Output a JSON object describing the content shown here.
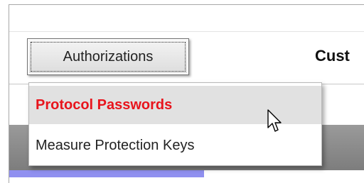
{
  "toolbar": {
    "authorizations_label": "Authorizations",
    "page_title": "Cust"
  },
  "menu": {
    "items": [
      {
        "label": "Protocol Passwords",
        "state": "highlighted"
      },
      {
        "label": "Measure Protection Keys",
        "state": "normal"
      }
    ]
  },
  "progress": {
    "fraction": 0.55
  },
  "colors": {
    "highlight_text": "#e8141c",
    "highlight_bg": "#e1e1e1",
    "band": "#8a8a8a",
    "progress_fill": "#9090f0"
  },
  "cursor": {
    "icon": "arrow-cursor-icon"
  }
}
